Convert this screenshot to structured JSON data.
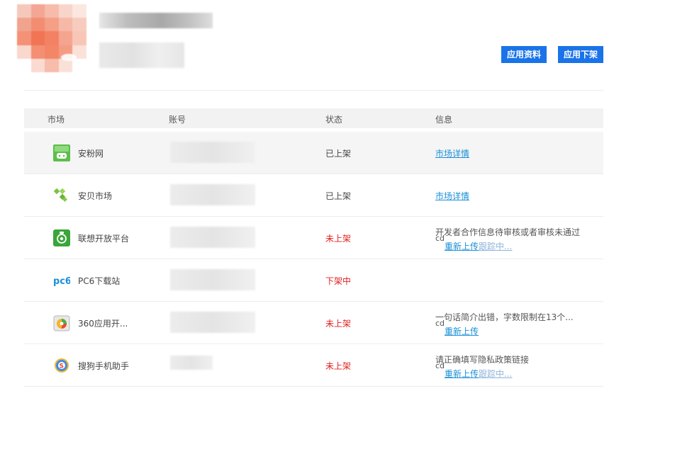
{
  "header": {
    "buttons": {
      "app_info": "应用资料",
      "app_offline": "应用下架"
    }
  },
  "table": {
    "columns": [
      "市场",
      "账号",
      "状态",
      "信息"
    ],
    "rows": [
      {
        "market": "安粉网",
        "icon": "anfen-icon",
        "status": "已上架",
        "info_link": "市场详情"
      },
      {
        "market": "安贝市场",
        "icon": "anbei-icon",
        "status": "已上架",
        "info_link": "市场详情"
      },
      {
        "market": "联想开放平台",
        "icon": "lenovo-icon",
        "status": "未上架",
        "info_message": "开发者合作信息待审核或者审核未通过",
        "info_cd": "cd",
        "reupload": "重新上传",
        "tracking": "跟踪中..."
      },
      {
        "market": "PC6下载站",
        "icon": "pc6-icon",
        "icon_text": "pc6",
        "status": "下架中"
      },
      {
        "market": "360应用开...",
        "icon": "360-icon",
        "status": "未上架",
        "info_message": "一句话简介出错，字数限制在13个...",
        "info_cd": "cd",
        "reupload": "重新上传"
      },
      {
        "market": "搜狗手机助手",
        "icon": "sogou-icon",
        "status": "未上架",
        "info_message": "请正确填写隐私政策链接",
        "info_cd": "cd",
        "reupload": "重新上传",
        "tracking": "跟踪中..."
      }
    ]
  },
  "colors": {
    "primary": "#1a73e8",
    "link": "#1a8fd8",
    "error": "#e02020",
    "header_bg": "#f2f2f2"
  }
}
